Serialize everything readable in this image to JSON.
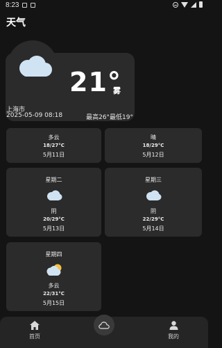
{
  "status": {
    "time": "8:23"
  },
  "app": {
    "title": "天气"
  },
  "current": {
    "temperature": "21°",
    "condition": "雾",
    "city": "上海市",
    "datetime": "2025-05-09 08:18",
    "range": "最高26°最低19°"
  },
  "forecast": [
    {
      "day": "",
      "condition": "多云",
      "temps": "18/27°C",
      "date": "5月11日",
      "icon": "partly-cloudy"
    },
    {
      "day": "",
      "condition": "晴",
      "temps": "18/29°C",
      "date": "5月12日",
      "icon": "sun"
    },
    {
      "day": "星期二",
      "condition": "阴",
      "temps": "20/29°C",
      "date": "5月13日",
      "icon": "cloud"
    },
    {
      "day": "星期三",
      "condition": "阴",
      "temps": "22/29°C",
      "date": "5月14日",
      "icon": "cloud"
    },
    {
      "day": "星期四",
      "condition": "多云",
      "temps": "22/31°C",
      "date": "5月15日",
      "icon": "partly-cloudy"
    }
  ],
  "nav": {
    "home_label": "首页",
    "mine_label": "我的"
  },
  "colors": {
    "background": "#141414",
    "card": "#2b2b2b",
    "cloud": "#cfe3f3",
    "sun": "#f5c242"
  }
}
